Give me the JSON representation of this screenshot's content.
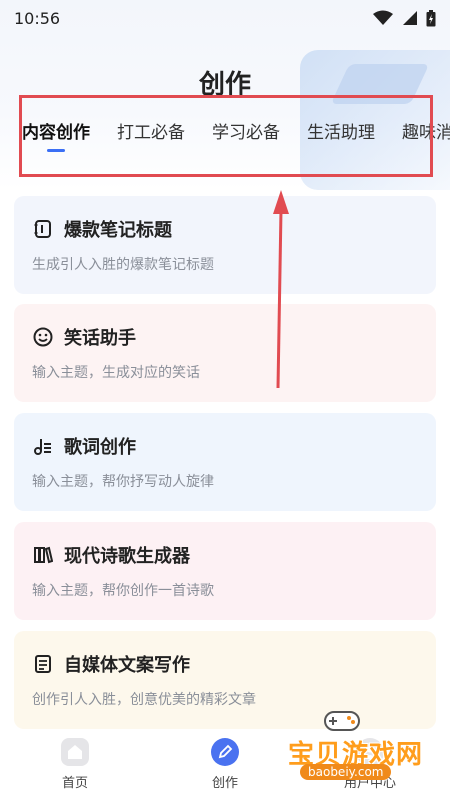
{
  "status_bar": {
    "time": "10:56"
  },
  "page": {
    "title": "创作"
  },
  "tabs": [
    {
      "label": "内容创作",
      "active": true
    },
    {
      "label": "打工必备",
      "active": false
    },
    {
      "label": "学习必备",
      "active": false
    },
    {
      "label": "生活助理",
      "active": false
    },
    {
      "label": "趣味消",
      "active": false
    }
  ],
  "cards": [
    {
      "title": "爆款笔记标题",
      "desc": "生成引人入胜的爆款笔记标题",
      "icon": "notebook-icon",
      "bg": "#f2f5fc"
    },
    {
      "title": "笑话助手",
      "desc": "输入主题，生成对应的笑话",
      "icon": "smile-icon",
      "bg": "#fdf3f3"
    },
    {
      "title": "歌词创作",
      "desc": "输入主题，帮你抒写动人旋律",
      "icon": "music-note-icon",
      "bg": "#eff5fd"
    },
    {
      "title": "现代诗歌生成器",
      "desc": "输入主题，帮你创作一首诗歌",
      "icon": "books-icon",
      "bg": "#fdf1f4"
    },
    {
      "title": "自媒体文案写作",
      "desc": "创作引人入胜，创意优美的精彩文章",
      "icon": "document-icon",
      "bg": "#fdf8ec"
    }
  ],
  "bottom_nav": [
    {
      "label": "首页",
      "icon": "home-icon"
    },
    {
      "label": "创作",
      "icon": "pen-icon"
    },
    {
      "label": "用户中心",
      "icon": "user-icon"
    }
  ],
  "watermark": {
    "text": "宝贝游戏网",
    "url": "baobeiy.com"
  },
  "colors": {
    "accent": "#3b6ff5",
    "highlight_box": "#e14b51",
    "arrow": "#e14b51"
  }
}
